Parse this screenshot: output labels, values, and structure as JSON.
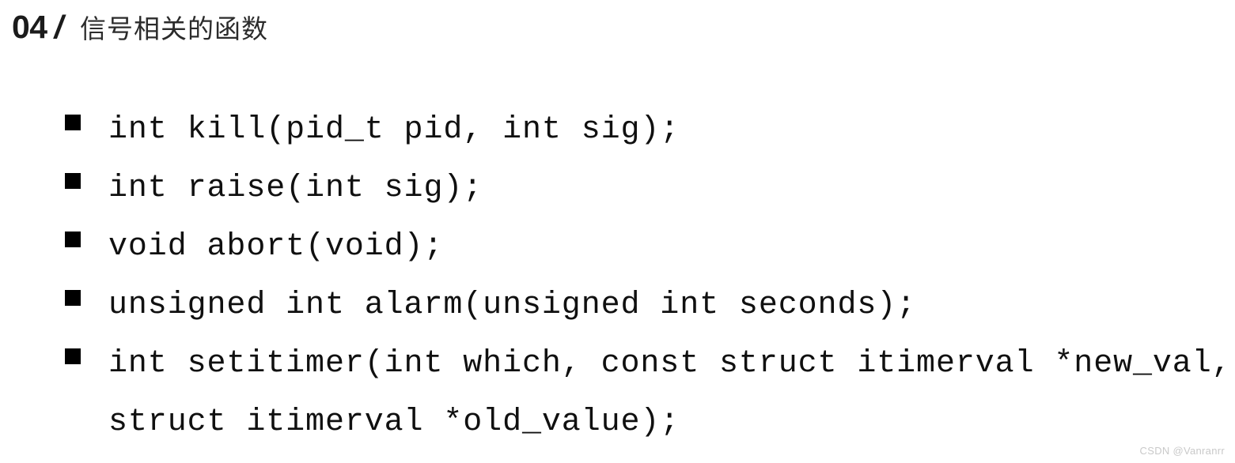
{
  "slide": {
    "background_color": "#ffffff"
  },
  "header": {
    "number": "04",
    "separator": "/",
    "title": "信号相关的函数",
    "number_color": "#1b1b1b",
    "title_color": "#2b2b2b"
  },
  "content": {
    "bullet_glyph": "filled-square",
    "bullet_color": "#000000",
    "items": [
      {
        "lines": [
          "int kill(pid_t pid, int sig);"
        ]
      },
      {
        "lines": [
          "int raise(int sig);"
        ]
      },
      {
        "lines": [
          "void abort(void);"
        ]
      },
      {
        "lines": [
          "unsigned int alarm(unsigned int seconds);"
        ]
      },
      {
        "lines": [
          "int setitimer(int which, const struct itimerval *new_val,",
          "struct itimerval *old_value);"
        ]
      }
    ]
  },
  "watermark": {
    "text": "CSDN @Vanranrr",
    "color": "#c9c9c9"
  }
}
